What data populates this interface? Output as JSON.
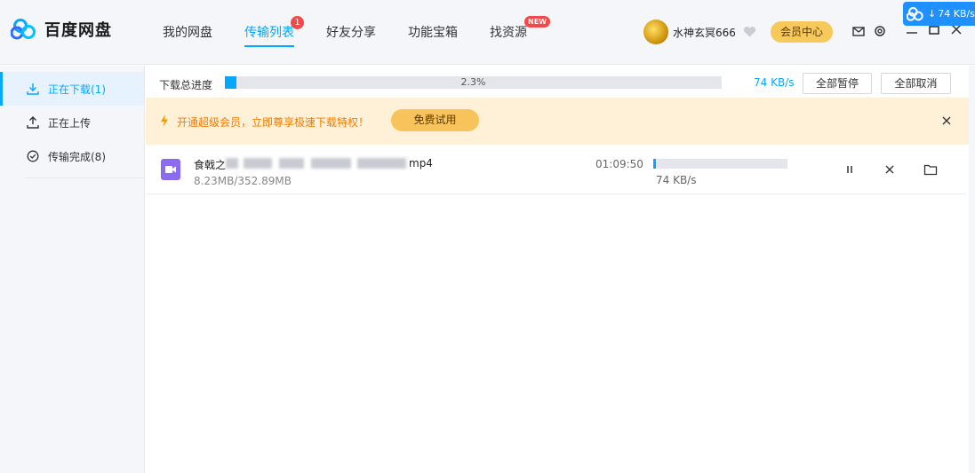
{
  "app": {
    "title": "百度网盘"
  },
  "nav": {
    "items": [
      {
        "label": "我的网盘"
      },
      {
        "label": "传输列表",
        "badge": "1"
      },
      {
        "label": "好友分享"
      },
      {
        "label": "功能宝箱"
      },
      {
        "label": "找资源",
        "badge": "NEW"
      }
    ],
    "active_index": 1
  },
  "user": {
    "name": "水神玄冥666",
    "vip_button": "会员中心"
  },
  "tray": {
    "speed": "74 KB/s"
  },
  "sidebar": {
    "items": [
      {
        "label": "正在下载(1)",
        "icon": "download-icon",
        "active": true
      },
      {
        "label": "正在上传",
        "icon": "upload-icon",
        "active": false
      },
      {
        "label": "传输完成(8)",
        "icon": "check-circle-icon",
        "active": false
      }
    ]
  },
  "progress": {
    "label": "下载总进度",
    "percent_text": "2.3%",
    "percent": 2.3,
    "speed": "74 KB/s",
    "pause_all": "全部暂停",
    "cancel_all": "全部取消"
  },
  "banner": {
    "text": "开通超级会员，立即尊享极速下载特权！",
    "button": "免费试用"
  },
  "tasks": [
    {
      "name_prefix": "食戟之",
      "name_suffix": "mp4",
      "size": "8.23MB/352.89MB",
      "time_left": "01:09:50",
      "speed": "74 KB/s",
      "progress": 2.3
    }
  ],
  "colors": {
    "accent": "#06a7ff",
    "badge": "#f24a4a",
    "vip": "#f7c85a",
    "banner_bg": "#fff1d8",
    "banner_text": "#f57c00",
    "file_icon": "#8a6cf0"
  }
}
